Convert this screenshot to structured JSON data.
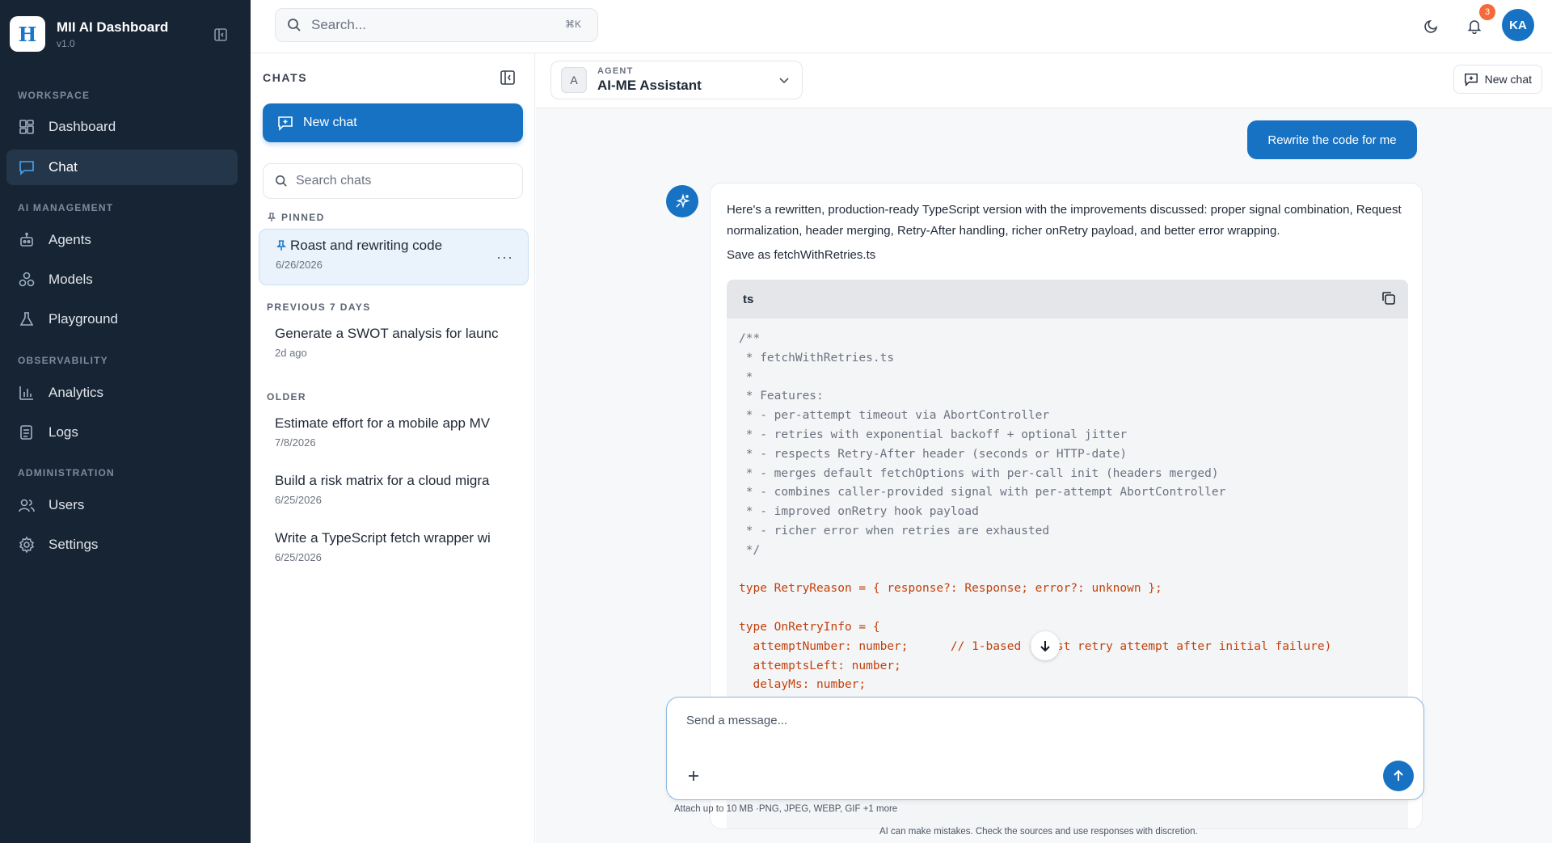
{
  "app": {
    "title": "MII AI Dashboard",
    "version": "v1.0",
    "logo_text": "H"
  },
  "sidebar": {
    "sections": [
      {
        "label": "WORKSPACE"
      },
      {
        "label": "AI MANAGEMENT"
      },
      {
        "label": "OBSERVABILITY"
      },
      {
        "label": "ADMINISTRATION"
      }
    ],
    "items": [
      {
        "label": "Dashboard",
        "icon": "dashboard-icon"
      },
      {
        "label": "Chat",
        "icon": "chat-icon",
        "active": true
      },
      {
        "label": "Agents",
        "icon": "agents-icon"
      },
      {
        "label": "Models",
        "icon": "models-icon"
      },
      {
        "label": "Playground",
        "icon": "flask-icon"
      },
      {
        "label": "Analytics",
        "icon": "bar-chart-icon"
      },
      {
        "label": "Logs",
        "icon": "logs-icon"
      },
      {
        "label": "Users",
        "icon": "users-icon"
      },
      {
        "label": "Settings",
        "icon": "gear-icon"
      }
    ]
  },
  "topbar": {
    "search_placeholder": "Search...",
    "shortcut": "⌘K",
    "notification_count": "3",
    "avatar_initials": "KA"
  },
  "chats_panel": {
    "title": "CHATS",
    "new_chat_label": "New chat",
    "search_placeholder": "Search chats",
    "groups": {
      "pinned": "PINNED",
      "previous": "PREVIOUS 7 DAYS",
      "older": "OLDER"
    },
    "pinned": [
      {
        "title": "Roast and rewriting code",
        "date": "6/26/2026"
      }
    ],
    "previous": [
      {
        "title": "Generate a SWOT analysis for launc",
        "date": "2d ago"
      }
    ],
    "older": [
      {
        "title": "Estimate effort for a mobile app MV",
        "date": "7/8/2026"
      },
      {
        "title": "Build a risk matrix for a cloud migra",
        "date": "6/25/2026"
      },
      {
        "title": "Write a TypeScript fetch wrapper wi",
        "date": "6/25/2026"
      }
    ]
  },
  "main": {
    "agent_caption": "AGENT",
    "agent_badge": "A",
    "agent_name": "AI-ME Assistant",
    "new_chat_label": "New chat",
    "user_message": "Rewrite the code for me",
    "ai_intro": "Here's a rewritten, production-ready TypeScript version with the improvements discussed: proper signal combination, Request normalization, header merging, Retry-After handling, richer onRetry payload, and better error wrapping.",
    "ai_save": "Save as fetchWithRetries.ts",
    "code_lang": "ts",
    "code_lines": [
      "/**",
      " * fetchWithRetries.ts",
      " *",
      " * Features:",
      " * - per-attempt timeout via AbortController",
      " * - retries with exponential backoff + optional jitter",
      " * - respects Retry-After header (seconds or HTTP-date)",
      " * - merges default fetchOptions with per-call init (headers merged)",
      " * - combines caller-provided signal with per-attempt AbortController",
      " * - improved onRetry hook payload",
      " * - richer error when retries are exhausted",
      " */",
      "",
      "type RetryReason = { response?: Response; error?: unknown };",
      "",
      "type OnRetryInfo = {",
      "  attemptNumber: number;      // 1-based (first retry attempt after initial failure)",
      "  attemptsLeft: number;",
      "  delayMs: number;"
    ],
    "composer_placeholder": "Send a message...",
    "attach_hint": "Attach up to 10 MB ·PNG, JPEG, WEBP, GIF +1 more",
    "disclaimer": "AI can make mistakes. Check the sources and use responses with discretion."
  },
  "colors": {
    "sidebar_bg": "#172433",
    "accent": "#1872c4",
    "badge": "#f46a3a"
  }
}
